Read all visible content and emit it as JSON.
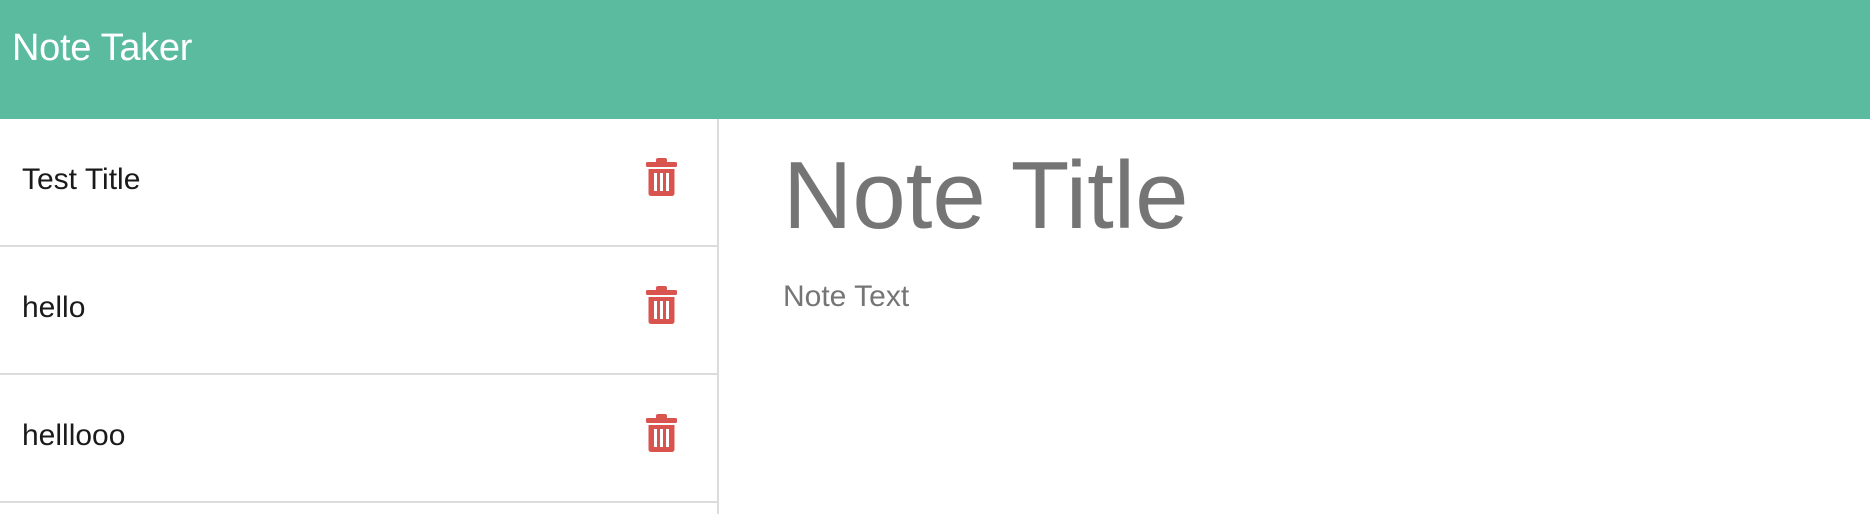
{
  "app": {
    "title": "Note Taker",
    "header_color": "#5abb9e"
  },
  "sidebar": {
    "notes": [
      {
        "label": "Test Title",
        "delete_icon": "trash-icon"
      },
      {
        "label": "hello",
        "delete_icon": "trash-icon"
      },
      {
        "label": "helllooo",
        "delete_icon": "trash-icon"
      }
    ],
    "delete_color": "#d9534f"
  },
  "editor": {
    "title_placeholder": "Note Title",
    "text_placeholder": "Note Text",
    "placeholder_color": "#767676"
  }
}
